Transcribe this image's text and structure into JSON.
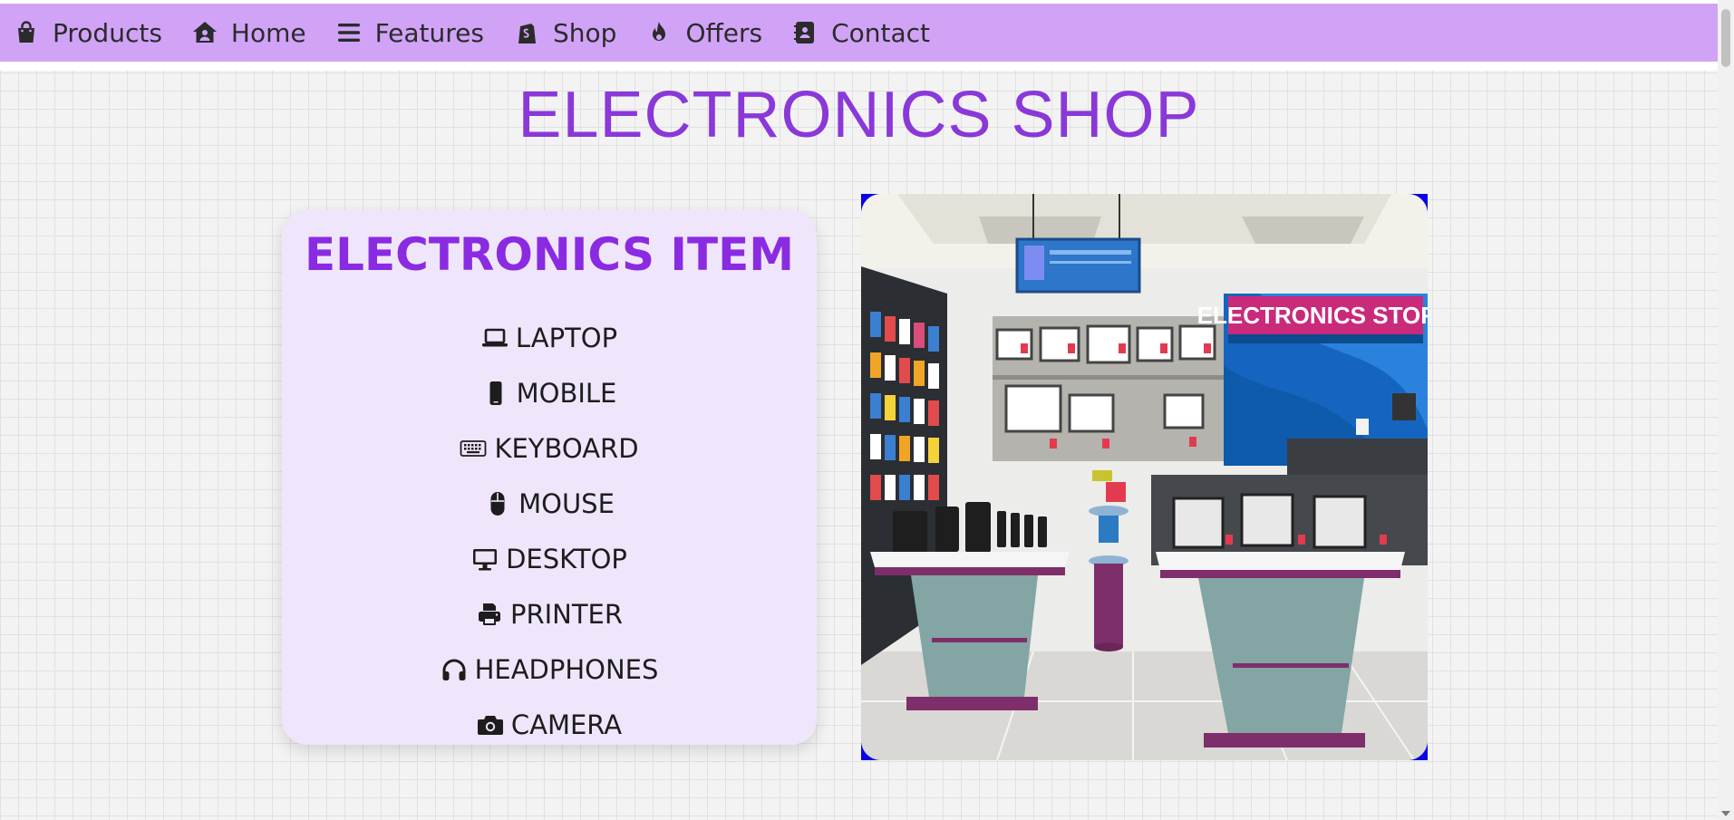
{
  "nav": {
    "items": [
      {
        "label": "Products",
        "icon": "shopping-bag-icon"
      },
      {
        "label": "Home",
        "icon": "house-user-icon"
      },
      {
        "label": "Features",
        "icon": "bars-icon"
      },
      {
        "label": "Shop",
        "icon": "shopify-icon"
      },
      {
        "label": "Offers",
        "icon": "fire-icon"
      },
      {
        "label": "Contact",
        "icon": "address-book-icon"
      }
    ]
  },
  "page": {
    "title": "ELECTRONICS SHOP"
  },
  "card": {
    "title": "ELECTRONICS ITEM",
    "items": [
      {
        "label": "LAPTOP",
        "icon": "laptop-icon"
      },
      {
        "label": "MOBILE",
        "icon": "mobile-icon"
      },
      {
        "label": "KEYBOARD",
        "icon": "keyboard-icon"
      },
      {
        "label": "MOUSE",
        "icon": "mouse-icon"
      },
      {
        "label": "DESKTOP",
        "icon": "desktop-icon"
      },
      {
        "label": "PRINTER",
        "icon": "printer-icon"
      },
      {
        "label": "HEADPHONES",
        "icon": "headphones-icon"
      },
      {
        "label": "CAMERA",
        "icon": "camera-icon"
      }
    ]
  },
  "image": {
    "sign_text": "ELECTRONICS STORE"
  },
  "colors": {
    "navbar": "#d1a3f7",
    "title": "#8a38d8",
    "card_bg": "#f0e6fc",
    "card_title": "#8a2be2",
    "image_frame": "#0a00e8"
  }
}
